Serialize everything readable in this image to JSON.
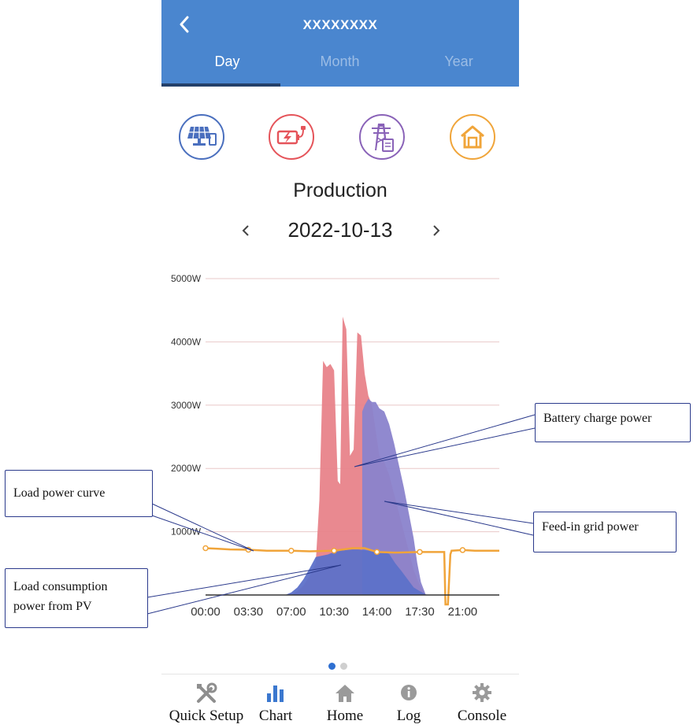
{
  "header": {
    "back_icon": "chevron-left-icon",
    "title": "XXXXXXXX",
    "tabs": [
      "Day",
      "Month",
      "Year"
    ],
    "active_tab": "Day",
    "bg_color": "#4a86cf"
  },
  "category_icons": [
    {
      "name": "solar-panel-icon",
      "color": "#4a6fbe"
    },
    {
      "name": "battery-charge-icon",
      "color": "#e5545a"
    },
    {
      "name": "grid-tower-icon",
      "color": "#8a63b8"
    },
    {
      "name": "home-icon",
      "color": "#f0a53a"
    }
  ],
  "section_title": "Production",
  "date": "2022-10-13",
  "chart_data": {
    "type": "area",
    "y_tick_labels": [
      "5000W",
      "4000W",
      "3000W",
      "2000W",
      "1000W"
    ],
    "y_ticks": [
      5000,
      4000,
      3000,
      2000,
      1000
    ],
    "ylim": [
      0,
      5000
    ],
    "x_tick_labels": [
      "00:00",
      "03:30",
      "07:00",
      "10:30",
      "14:00",
      "17:30",
      "21:00"
    ],
    "x_ticks": [
      0,
      3.5,
      7,
      10.5,
      14,
      17.5,
      21
    ],
    "xlim": [
      0,
      24
    ],
    "grid": true,
    "series": [
      {
        "color": "#e8838a",
        "x": [
          7.0,
          7.5,
          8.0,
          8.5,
          9.0,
          9.3,
          9.6,
          9.9,
          10.2,
          10.5,
          10.8,
          11.0,
          11.2,
          11.5,
          11.8,
          12.1,
          12.4,
          12.7,
          13.0,
          13.3,
          13.6,
          13.9,
          14.2,
          14.6,
          15.0,
          15.4,
          15.8,
          16.2,
          16.6,
          17.0,
          17.3,
          17.6,
          18.0
        ],
        "y": [
          0,
          60,
          150,
          300,
          500,
          1500,
          3700,
          3600,
          3650,
          3550,
          1800,
          1750,
          4400,
          4200,
          2200,
          2300,
          4150,
          4100,
          3500,
          3150,
          3000,
          2600,
          2200,
          2100,
          1900,
          1600,
          1300,
          1000,
          700,
          400,
          250,
          120,
          0
        ]
      },
      {
        "color": "#8a83cc",
        "x": [
          12.8,
          13.0,
          13.3,
          13.6,
          13.9,
          14.2,
          14.6,
          15.0,
          15.4,
          15.8,
          16.2,
          16.6,
          17.0,
          17.3,
          17.6,
          18.0
        ],
        "y": [
          2900,
          3000,
          3100,
          3050,
          3050,
          2950,
          2900,
          2700,
          2400,
          2050,
          1700,
          1300,
          900,
          500,
          200,
          0
        ]
      },
      {
        "color": "#5d71c9",
        "x": [
          6.5,
          7.0,
          7.5,
          8.0,
          8.5,
          9.0,
          9.5,
          10.0,
          10.5,
          11.0,
          11.5,
          12.0,
          12.5,
          13.0,
          13.5,
          14.0,
          14.5,
          15.0,
          15.5,
          16.0,
          16.5,
          17.0,
          17.5,
          18.0,
          18.3
        ],
        "y": [
          0,
          40,
          120,
          250,
          420,
          600,
          620,
          640,
          680,
          700,
          710,
          720,
          720,
          710,
          700,
          690,
          680,
          650,
          500,
          380,
          250,
          120,
          60,
          10,
          0
        ]
      },
      {
        "color": "#f0a43a",
        "x": [
          0,
          1,
          2,
          3.5,
          5,
          7,
          8.5,
          10.5,
          12,
          13,
          14,
          15.5,
          17.5,
          19.5,
          19.6,
          19.8,
          20.0,
          20.1,
          21,
          22,
          23,
          24
        ],
        "y": [
          740,
          730,
          720,
          715,
          700,
          700,
          690,
          700,
          740,
          740,
          680,
          670,
          680,
          680,
          -150,
          -150,
          640,
          700,
          710,
          700,
          700,
          700
        ]
      }
    ]
  },
  "callouts": {
    "battery_charge": "Battery charge power",
    "load_curve": "Load power curve",
    "feed_in": "Feed-in grid power",
    "load_pv_line1": "Load consumption",
    "load_pv_line2": "power from PV"
  },
  "pager": {
    "current": 1,
    "total": 2,
    "active_color": "#2e6fd1",
    "inactive_color": "#cfcfcf"
  },
  "nav": {
    "items": [
      {
        "label": "Quick Setup",
        "icon": "tools-icon"
      },
      {
        "label": "Chart",
        "icon": "bar-chart-icon"
      },
      {
        "label": "Home",
        "icon": "home-icon"
      },
      {
        "label": "Log",
        "icon": "info-icon"
      },
      {
        "label": "Console",
        "icon": "gear-icon"
      }
    ],
    "active": "Chart"
  }
}
